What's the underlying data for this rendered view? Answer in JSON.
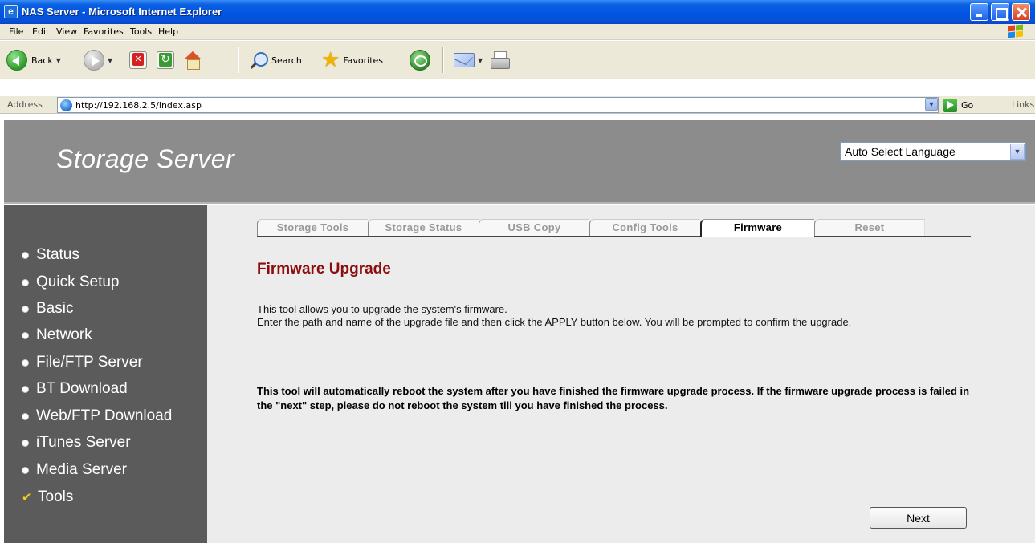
{
  "window": {
    "title": "NAS Server - Microsoft Internet Explorer"
  },
  "menu": [
    "File",
    "Edit",
    "View",
    "Favorites",
    "Tools",
    "Help"
  ],
  "toolbar": {
    "back_label": "Back",
    "search_label": "Search",
    "favorites_label": "Favorites"
  },
  "address": {
    "label": "Address",
    "url": "http://192.168.2.5/index.asp",
    "go_label": "Go",
    "links_label": "Links"
  },
  "header": {
    "brand": "Storage Server",
    "language": "Auto Select Language"
  },
  "nav": {
    "items": [
      "Status",
      "Quick Setup",
      "Basic",
      "Network",
      "File/FTP Server",
      "BT Download",
      "Web/FTP Download",
      "iTunes Server",
      "Media Server",
      "Tools"
    ],
    "active": "Tools"
  },
  "tabs": [
    "Storage Tools",
    "Storage Status",
    "USB Copy",
    "Config Tools",
    "Firmware",
    "Reset"
  ],
  "active_tab": "Firmware",
  "main": {
    "heading": "Firmware Upgrade",
    "desc_line1": "This tool allows you to upgrade the system's firmware.",
    "desc_line2": "Enter the path and name of the upgrade file and then click the APPLY button below. You will be prompted to confirm the upgrade.",
    "warning": "This tool will automatically reboot the system after you have finished the firmware upgrade process. If the firmware upgrade process is failed in the \"next\" step, please do not reboot the system till you have finished the process.",
    "next_label": "Next"
  },
  "colors": {
    "titlebar": "#0054e3",
    "header": "#8c8c8c",
    "sidebar": "#5b5b5b",
    "content_bg": "#ececec",
    "heading": "#8b0d0d",
    "check": "#f2d21b"
  }
}
